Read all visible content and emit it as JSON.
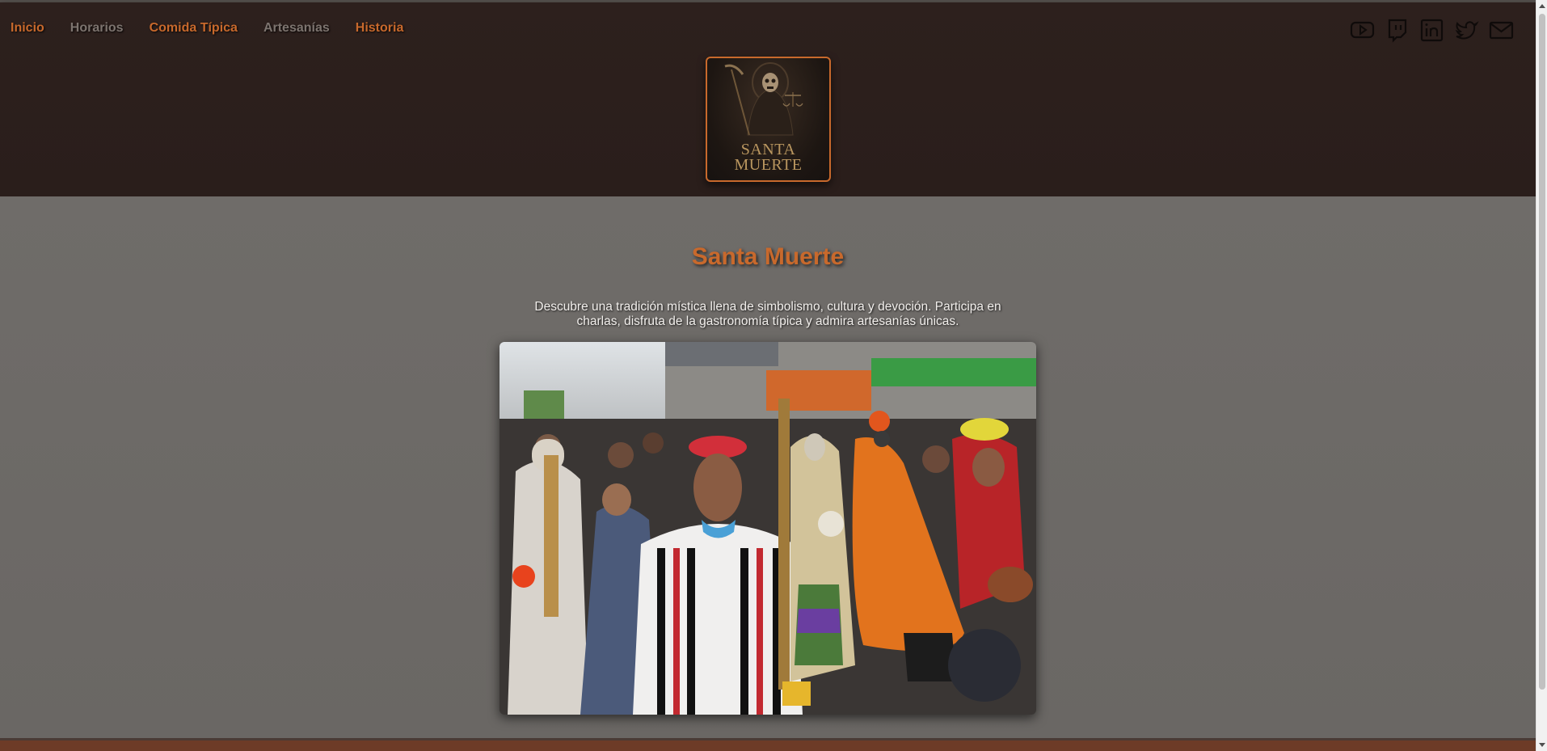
{
  "nav": {
    "items": [
      {
        "label": "Inicio",
        "style": "accent"
      },
      {
        "label": "Horarios",
        "style": "muted"
      },
      {
        "label": "Comida Típica",
        "style": "accent"
      },
      {
        "label": "Artesanías",
        "style": "muted"
      },
      {
        "label": "Historia",
        "style": "accent"
      }
    ]
  },
  "social": {
    "icons": [
      "youtube-icon",
      "twitch-icon",
      "linkedin-icon",
      "twitter-icon",
      "mail-icon"
    ]
  },
  "logo": {
    "line1": "SANTA",
    "line2": "MUERTE"
  },
  "hero": {
    "title": "Santa Muerte",
    "description": "Descubre una tradición mística llena de simbolismo, cultura y devoción. Participa en charlas, disfruta de la gastronomía típica y admira artesanías únicas."
  },
  "colors": {
    "accent": "#c8692c",
    "muted": "#7d746f",
    "header_bg": "#2b1f1c",
    "main_bg": "#6c6966",
    "footer": "#6d3b27"
  }
}
